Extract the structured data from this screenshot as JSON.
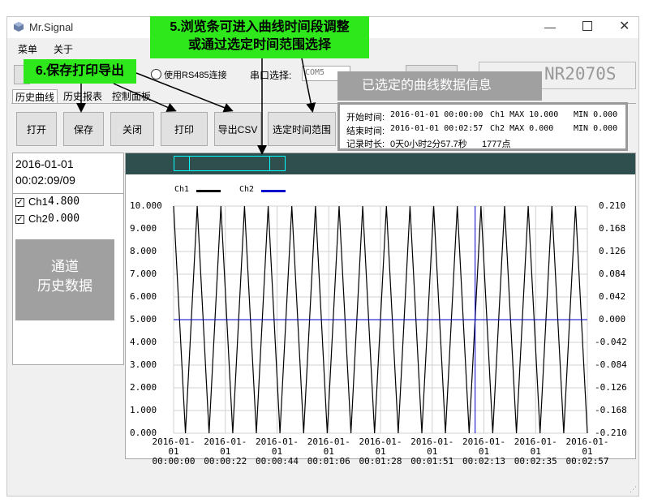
{
  "window": {
    "title": "Mr.Signal"
  },
  "menu": {
    "items": [
      "菜单",
      "关于"
    ]
  },
  "connection": {
    "rs485_label": "使用RS485连接",
    "port_label": "串口选择:",
    "port_value": "COM5",
    "device_model": "NR2070S"
  },
  "tabs": [
    "历史曲线",
    "历史报表",
    "控制面板"
  ],
  "toolbar": {
    "open": "打开",
    "save": "保存",
    "close": "关闭",
    "print": "打印",
    "export": "导出CSV",
    "select_range": "选定时间范围"
  },
  "callouts": {
    "browse_line1": "5.浏览条可进入曲线时间段调整",
    "browse_line2": "或通过选定时间范围选择",
    "save_print": "6.保存打印导出",
    "selected_info": "已选定的曲线数据信息"
  },
  "info": {
    "start_label": "开始时间:",
    "start": "2016-01-01 00:00:00",
    "end_label": "结束时间:",
    "end": "2016-01-01 00:02:57",
    "duration_label": "记录时长:",
    "duration": "0天0小时2分57.7秒",
    "points": "1777点",
    "ch1_max": "Ch1 MAX 10.000",
    "ch1_min": "MIN 0.000",
    "ch2_max": "Ch2 MAX 0.000",
    "ch2_min": "MIN 0.000"
  },
  "cursor": {
    "date": "2016-01-01",
    "time": "00:02:09/09"
  },
  "channels": [
    {
      "label": "Ch1",
      "value": "4.800",
      "checked": true
    },
    {
      "label": "Ch2",
      "value": "0.000",
      "checked": true
    }
  ],
  "history_button": {
    "line1": "通道",
    "line2": "历史数据"
  },
  "colors": {
    "ch1": "#000000",
    "ch2": "#0000cc",
    "callout": "#2ee81c",
    "overview_bar": "#2f4f4f",
    "overview_window": "#00ffff"
  },
  "chart_data": {
    "type": "line",
    "series": [
      {
        "name": "Ch1",
        "color": "#000000",
        "waveform": "triangle",
        "min": 0,
        "max": 10,
        "cycles": 17.5
      },
      {
        "name": "Ch2",
        "color": "#0000cc",
        "value": 0
      }
    ],
    "y_left": {
      "ticks": [
        "10.000",
        "9.000",
        "8.000",
        "7.000",
        "6.000",
        "5.000",
        "4.000",
        "3.000",
        "2.000",
        "1.000",
        "0.000"
      ],
      "range": [
        0,
        10
      ]
    },
    "y_right": {
      "ticks": [
        "0.210",
        "0.168",
        "0.126",
        "0.084",
        "0.042",
        "0.000",
        "-0.042",
        "-0.084",
        "-0.126",
        "-0.168",
        "-0.210"
      ],
      "range": [
        -0.21,
        0.21
      ]
    },
    "x_ticks": [
      {
        "date": "2016-01-01",
        "time": "00:00:00"
      },
      {
        "date": "2016-01-01",
        "time": "00:00:22"
      },
      {
        "date": "2016-01-01",
        "time": "00:00:44"
      },
      {
        "date": "2016-01-01",
        "time": "00:01:06"
      },
      {
        "date": "2016-01-01",
        "time": "00:01:28"
      },
      {
        "date": "2016-01-01",
        "time": "00:01:51"
      },
      {
        "date": "2016-01-01",
        "time": "00:02:13"
      },
      {
        "date": "2016-01-01",
        "time": "00:02:35"
      },
      {
        "date": "2016-01-01",
        "time": "00:02:57"
      }
    ],
    "cursor_time": "00:02:09",
    "grid": true
  }
}
